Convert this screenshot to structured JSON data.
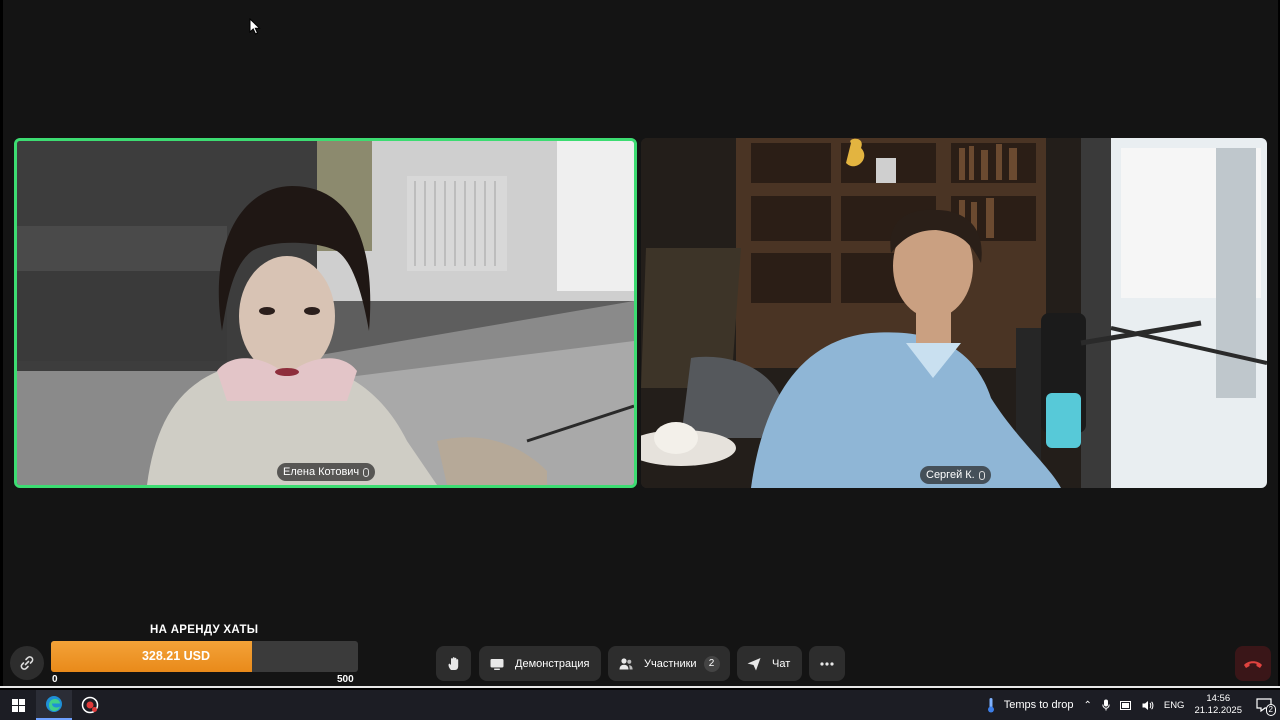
{
  "participants": [
    {
      "name": "Елена Котович",
      "speaking": true
    },
    {
      "name": "Сергей К.",
      "speaking": false
    }
  ],
  "goal": {
    "title": "НА АРЕНДУ ХАТЫ",
    "amount_label": "328.21 USD",
    "min_label": "0",
    "max_label": "500",
    "progress_fraction": 0.656,
    "fill_color": "#ec8f20"
  },
  "controls": {
    "raise_hand_icon": "hand-icon",
    "demo_label": "Демонстрация",
    "participants_label": "Участники",
    "participants_count": "2",
    "chat_label": "Чат",
    "more_icon": "more-dots-icon",
    "hangup_icon": "phone-hangup-icon"
  },
  "taskbar": {
    "weather_label": "Temps to drop",
    "language": "ENG",
    "time": "14:56",
    "date": "21.12.2025",
    "notification_count": "2"
  },
  "colors": {
    "active_speaker_border": "#3ddc72",
    "background": "#141414",
    "hangup": "#e0433f"
  }
}
